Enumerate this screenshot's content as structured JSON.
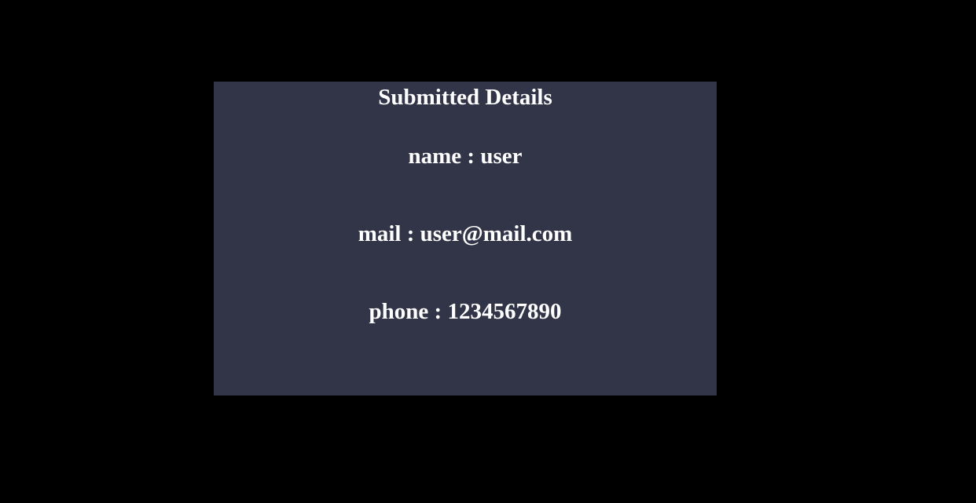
{
  "card": {
    "title": "Submitted Details",
    "background_color": "#323448",
    "text_color": "#ffffff"
  },
  "details": {
    "name": "name : user",
    "mail": "mail : user@mail.com",
    "phone": "phone : 1234567890"
  },
  "page": {
    "background_color": "#000000"
  }
}
